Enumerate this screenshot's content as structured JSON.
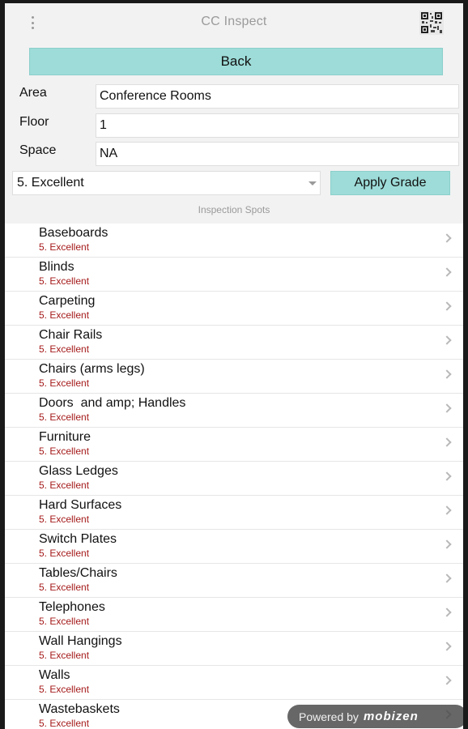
{
  "header": {
    "title": "CC Inspect",
    "menu_icon": "more-vert-icon",
    "qr_icon": "qr-code-icon"
  },
  "back_button": {
    "label": "Back"
  },
  "fields": [
    {
      "label": "Area",
      "value": "Conference Rooms"
    },
    {
      "label": "Floor",
      "value": "1"
    },
    {
      "label": "Space",
      "value": "NA"
    }
  ],
  "grade": {
    "selected": "5. Excellent",
    "apply_label": "Apply Grade"
  },
  "section_label": "Inspection Spots",
  "spots": [
    {
      "name": "Baseboards",
      "grade": "5. Excellent"
    },
    {
      "name": "Blinds",
      "grade": "5. Excellent"
    },
    {
      "name": "Carpeting",
      "grade": "5. Excellent"
    },
    {
      "name": "Chair Rails",
      "grade": "5. Excellent"
    },
    {
      "name": "Chairs (arms legs)",
      "grade": "5. Excellent"
    },
    {
      "name": "Doors  and amp; Handles",
      "grade": "5. Excellent"
    },
    {
      "name": "Furniture",
      "grade": "5. Excellent"
    },
    {
      "name": "Glass Ledges",
      "grade": "5. Excellent"
    },
    {
      "name": "Hard Surfaces",
      "grade": "5. Excellent"
    },
    {
      "name": "Switch Plates",
      "grade": "5. Excellent"
    },
    {
      "name": "Tables/Chairs",
      "grade": "5. Excellent"
    },
    {
      "name": "Telephones",
      "grade": "5. Excellent"
    },
    {
      "name": "Wall Hangings",
      "grade": "5. Excellent"
    },
    {
      "name": "Walls",
      "grade": "5. Excellent"
    },
    {
      "name": "Wastebaskets",
      "grade": "5. Excellent"
    }
  ],
  "watermark": {
    "text": "Powered by",
    "brand": "mobizen"
  },
  "colors": {
    "accent": "#9ddcd8",
    "grade_text": "#a51a1a",
    "muted": "#9a9a9a"
  }
}
